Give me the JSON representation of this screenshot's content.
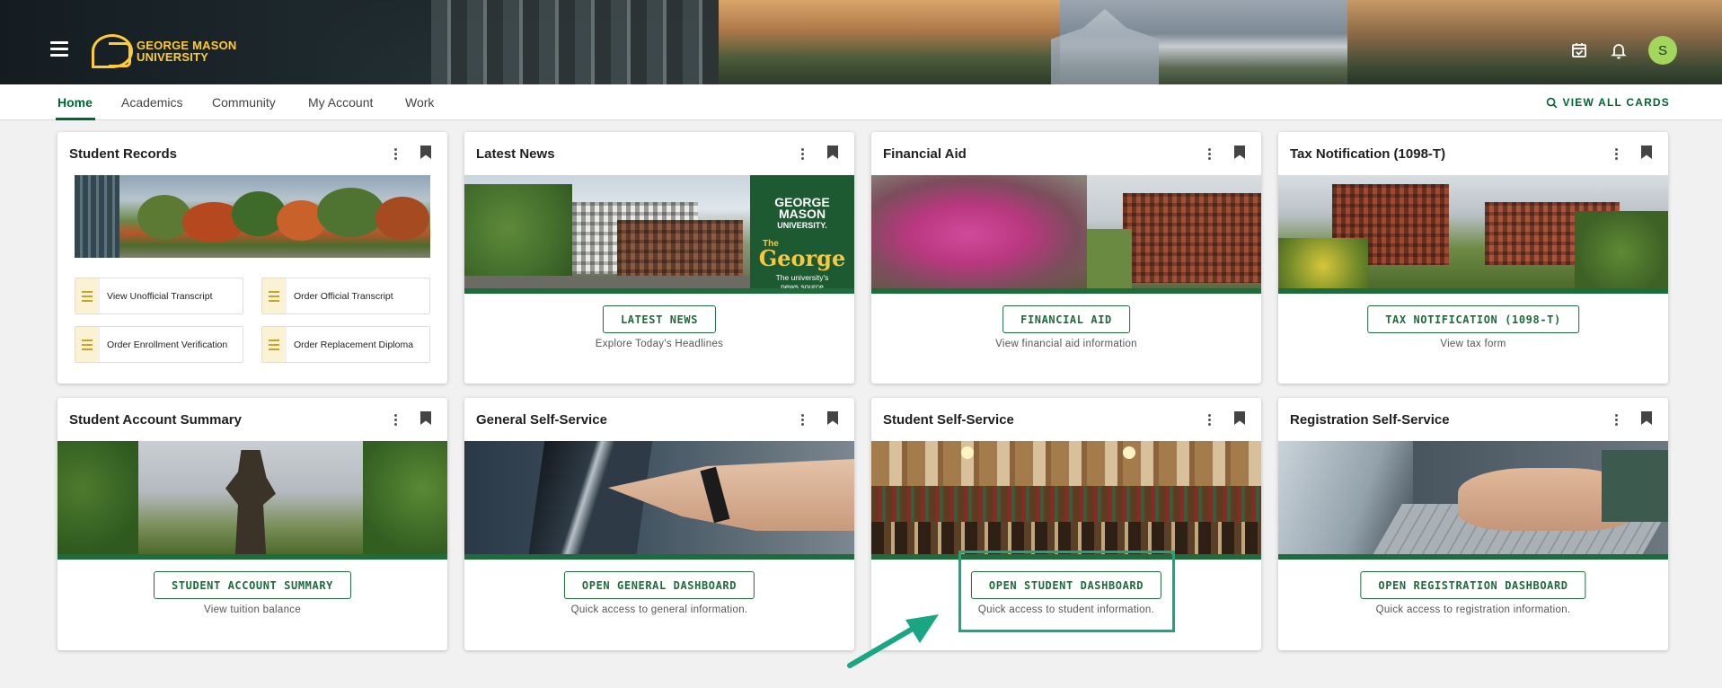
{
  "header": {
    "logo_line1": "GEORGE MASON",
    "logo_line2": "UNIVERSITY",
    "avatar_initial": "S",
    "icons": [
      "menu-icon",
      "calendar-check-icon",
      "bell-icon"
    ]
  },
  "tabs": [
    {
      "label": "Home",
      "active": true
    },
    {
      "label": "Academics",
      "active": false
    },
    {
      "label": "Community",
      "active": false
    },
    {
      "label": "My Account",
      "active": false
    },
    {
      "label": "Work",
      "active": false
    }
  ],
  "view_all_label": "VIEW ALL CARDS",
  "cards": {
    "student_records": {
      "title": "Student Records",
      "links": [
        "View Unofficial Transcript",
        "Order Official Transcript",
        "Order Enrollment Verification",
        "Order Replacement Diploma"
      ]
    },
    "latest_news": {
      "title": "Latest News",
      "button": "LATEST NEWS",
      "desc": "Explore Today's Headlines",
      "promo_line1": "GEORGE",
      "promo_line2": "MASON",
      "promo_line3": "UNIVERSITY.",
      "promo_the": "The",
      "promo_george": "George",
      "promo_tag1": "The university's",
      "promo_tag2": "news source"
    },
    "financial_aid": {
      "title": "Financial Aid",
      "button": "FINANCIAL AID",
      "desc": "View financial aid information"
    },
    "tax_notification": {
      "title": "Tax Notification (1098-T)",
      "button": "TAX NOTIFICATION (1098-T)",
      "desc": "View tax form"
    },
    "student_account": {
      "title": "Student Account Summary",
      "button": "STUDENT ACCOUNT SUMMARY",
      "desc": "View tuition balance"
    },
    "general_self_service": {
      "title": "General Self-Service",
      "button": "OPEN GENERAL DASHBOARD",
      "desc": "Quick access to general information."
    },
    "student_self_service": {
      "title": "Student Self-Service",
      "button": "OPEN STUDENT DASHBOARD",
      "desc": "Quick access to student information."
    },
    "registration_self_service": {
      "title": "Registration Self-Service",
      "button": "OPEN REGISTRATION DASHBOARD",
      "desc": "Quick access to registration information."
    }
  },
  "colors": {
    "brand_green": "#006633",
    "brand_gold": "#ffcc33",
    "highlight": "#1aa583"
  }
}
